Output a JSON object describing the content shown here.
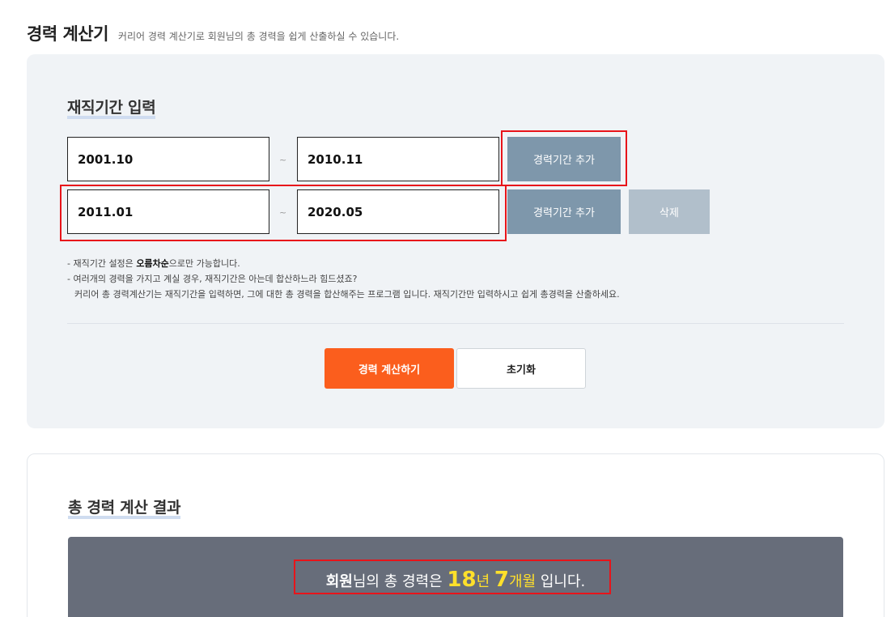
{
  "header": {
    "title": "경력 계산기",
    "subtitle": "커리어 경력 계산기로 회원님의 총 경력을 쉽게 산출하실 수 있습니다."
  },
  "input_section": {
    "heading": "재직기간 입력",
    "periods": [
      {
        "start": "2001.10",
        "separator": "~",
        "end": "2010.11",
        "add_label": "경력기간 추가"
      },
      {
        "start": "2011.01",
        "separator": "~",
        "end": "2020.05",
        "add_label": "경력기간 추가",
        "delete_label": "삭제"
      }
    ],
    "notes": {
      "line1_prefix": "- 재직기간 설정은 ",
      "line1_bold": "오름차순",
      "line1_suffix": "으로만 가능합니다.",
      "line2": "- 여러개의 경력을 가지고 계실 경우, 재직기간은 아는데 합산하느라 힘드셨죠?",
      "line3": "커리어 총 경력계산기는 재직기간을 입력하면, 그에 대한 총 경력을 합산해주는 프로그램 입니다. 재직기간만 입력하시고 쉽게 총경력을 산출하세요."
    },
    "calculate_label": "경력 계산하기",
    "reset_label": "초기화"
  },
  "result_section": {
    "heading": "총 경력 계산 결과",
    "name": "회원",
    "text_before": "님의 총 경력은 ",
    "years": "18",
    "years_unit": "년",
    "months": "7",
    "months_unit": "개월",
    "text_after": " 입니다."
  },
  "colors": {
    "accent_orange": "#fb5e1d",
    "add_button": "#7e97ab",
    "delete_button": "#b1bfcb",
    "panel_bg": "#f0f3f6",
    "result_bg": "#676d7a",
    "highlight_yellow": "#ffe02b",
    "annotation_red": "#e8141a"
  }
}
